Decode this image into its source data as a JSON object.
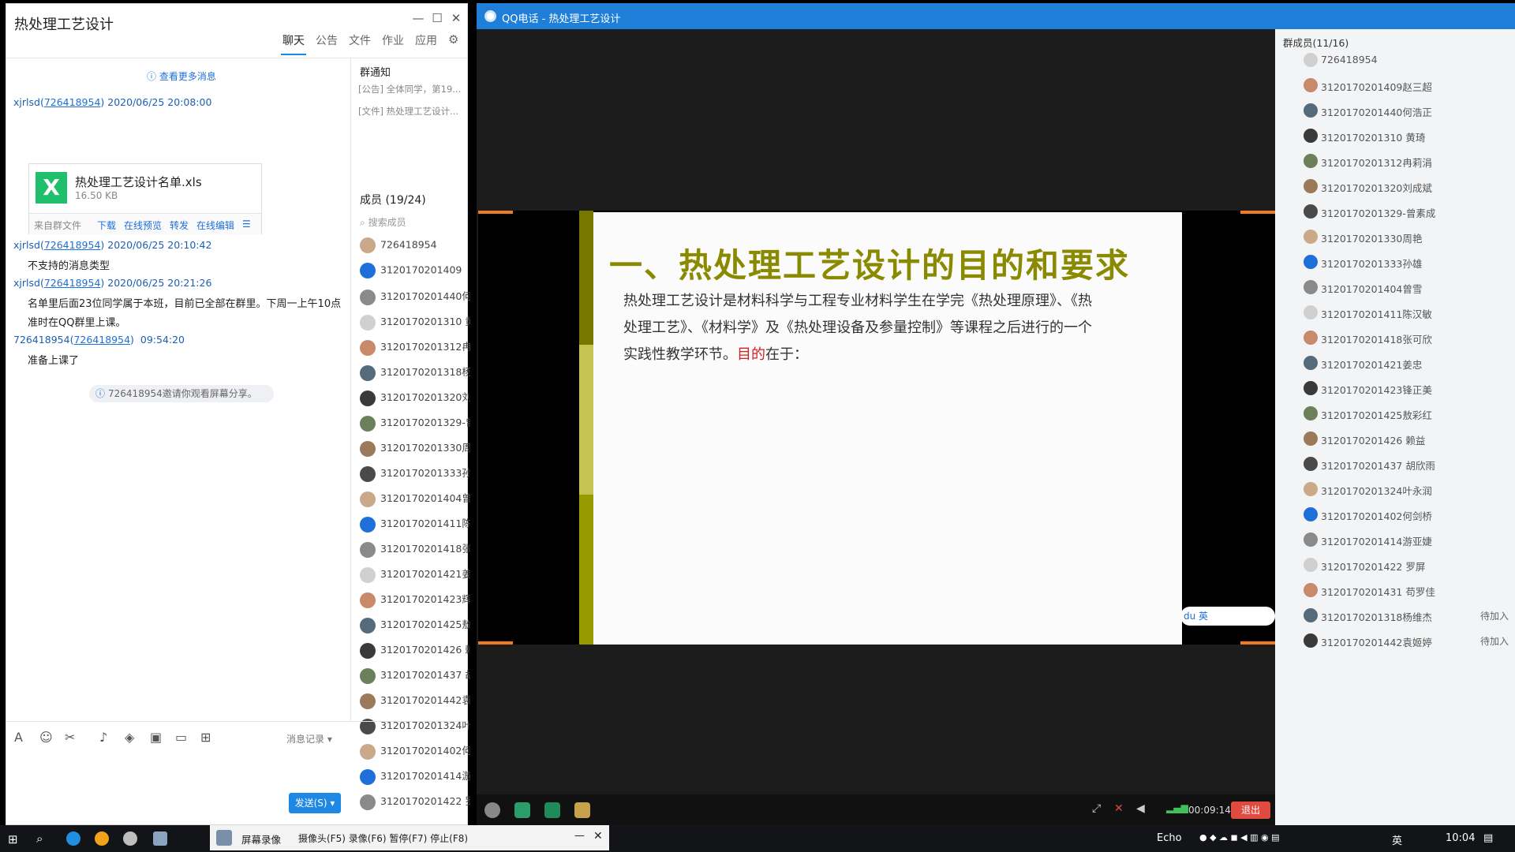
{
  "chat": {
    "title": "热处理工艺设计",
    "tabs": [
      "聊天",
      "公告",
      "文件",
      "作业",
      "应用"
    ],
    "view_more": "查看更多消息",
    "messages": [
      {
        "sender": "xjrlsd",
        "sender_id": "726418954",
        "time": "2020/06/25 20:08:00"
      },
      {
        "sender": "xjrlsd",
        "sender_id": "726418954",
        "time": "2020/06/25 20:10:42",
        "text": "不支持的消息类型"
      },
      {
        "sender": "xjrlsd",
        "sender_id": "726418954",
        "time": "2020/06/25 20:21:26",
        "text1": "名单里后面23位同学属于本班，目前已全部在群里。下周一上午10点",
        "text2": "准时在QQ群里上课。"
      },
      {
        "sender": "726418954",
        "sender_id": "726418954",
        "time": "09:54:20",
        "text": "准备上课了"
      }
    ],
    "file": {
      "name": "热处理工艺设计名单.xls",
      "size": "16.50 KB",
      "source": "来自群文件",
      "actions": [
        "下载",
        "在线预览",
        "转发",
        "在线编辑"
      ]
    },
    "invite": "726418954邀请你观看屏幕分享。",
    "history": "消息记录",
    "send": "发送(S)"
  },
  "side": {
    "notice_title": "群通知",
    "notices": [
      "[公告] 全体同学，第19...",
      "[文件] 热处理工艺设计..."
    ],
    "members_head": "成员 (19/24)",
    "search_placeholder": "搜索成员",
    "members": [
      "726418954",
      "3120170201409",
      "3120170201440何",
      "3120170201310 黄",
      "3120170201312冉",
      "3120170201318杨",
      "3120170201320刘",
      "3120170201329-曾",
      "3120170201330周",
      "3120170201333孙",
      "3120170201404曾",
      "3120170201411陈",
      "3120170201418张",
      "3120170201421姜",
      "3120170201423辉",
      "3120170201425敖",
      "3120170201426 赖",
      "3120170201437 胡",
      "3120170201442袁",
      "3120170201324叶",
      "3120170201402何",
      "3120170201414游",
      "3120170201422 罗"
    ]
  },
  "call": {
    "title": "QQ电话 - 热处理工艺设计",
    "slide": {
      "title": "一、热处理工艺设计的目的和要求",
      "body_a": "热处理工艺设计是材料科学与工程专业材料学生在学完《热处理原理》、《热处理工艺》、《材料学》及《热处理设备及参量控制》等课程之后进行的一个实践性教学环节。",
      "body_red": "目的",
      "body_b": "在于："
    },
    "ime": "du 英",
    "timer": "00:09:14",
    "exit": "退出",
    "roster_title": "群成员(11/16)",
    "roster": [
      {
        "name": "726418954",
        "status": ""
      },
      {
        "name": "3120170201409赵三超",
        "status": ""
      },
      {
        "name": "3120170201440何浩正",
        "status": ""
      },
      {
        "name": "3120170201310 黄琦",
        "status": ""
      },
      {
        "name": "3120170201312冉莉涓",
        "status": ""
      },
      {
        "name": "3120170201320刘成斌",
        "status": ""
      },
      {
        "name": "3120170201329-曾素成",
        "status": ""
      },
      {
        "name": "3120170201330周艳",
        "status": ""
      },
      {
        "name": "3120170201333孙雄",
        "status": ""
      },
      {
        "name": "3120170201404曾雪",
        "status": ""
      },
      {
        "name": "3120170201411陈汉敏",
        "status": ""
      },
      {
        "name": "3120170201418张可欣",
        "status": ""
      },
      {
        "name": "3120170201421姜忠",
        "status": ""
      },
      {
        "name": "3120170201423锋正美",
        "status": ""
      },
      {
        "name": "3120170201425敖彩红",
        "status": ""
      },
      {
        "name": "3120170201426 赖益",
        "status": ""
      },
      {
        "name": "3120170201437 胡欣雨",
        "status": ""
      },
      {
        "name": "3120170201324叶永润",
        "status": ""
      },
      {
        "name": "3120170201402何剑桥",
        "status": ""
      },
      {
        "name": "3120170201414游亚婕",
        "status": ""
      },
      {
        "name": "3120170201422 罗屏",
        "status": ""
      },
      {
        "name": "3120170201431 苟罗佳",
        "status": ""
      },
      {
        "name": "3120170201318杨维杰",
        "status": "待加入"
      },
      {
        "name": "3120170201442袁姬婷",
        "status": "待加入"
      }
    ]
  },
  "recorder": {
    "title": "屏幕录像",
    "hint": "摄像头(F5) 录像(F6) 暂停(F7) 停止(F8)"
  },
  "taskbar": {
    "echo": "Echo",
    "lang": "英",
    "clock": "10:04"
  },
  "colors": {
    "accent": "#1e88e5",
    "slide_title": "#8a8a00",
    "exit": "#e04a3f"
  }
}
